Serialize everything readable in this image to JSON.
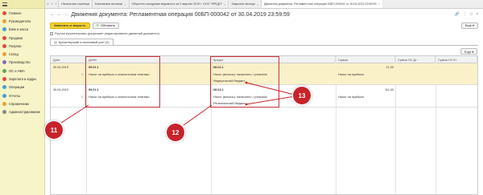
{
  "sidebar": {
    "items": [
      {
        "label": "Главное",
        "color": "#e24c3c"
      },
      {
        "label": "Руководителю",
        "color": "#e8a03b"
      },
      {
        "label": "Банк и касса",
        "color": "#4b9bd6"
      },
      {
        "label": "Продажи",
        "color": "#e24c3c"
      },
      {
        "label": "Покупки",
        "color": "#e24c3c"
      },
      {
        "label": "Склад",
        "color": "#e8a03b"
      },
      {
        "label": "Производство",
        "color": "#8a6bbe"
      },
      {
        "label": "ОС и НМА",
        "color": "#6aa84f"
      },
      {
        "label": "Зарплата и кадры",
        "color": "#e24c3c"
      },
      {
        "label": "Операции",
        "color": "#4b9bd6"
      },
      {
        "label": "Отчеты",
        "color": "#4b9bd6"
      },
      {
        "label": "Справочники",
        "color": "#e8a03b"
      },
      {
        "label": "Администрирование",
        "color": "#888888"
      }
    ]
  },
  "tabs": [
    {
      "label": "Начальная страница"
    },
    {
      "label": "Банковские выписки"
    },
    {
      "label": "Оборотно-сальдовая ведомость за 2 квартал 2019 г. ООО \"КРЕДО\""
    },
    {
      "label": "Закрытие месяца"
    },
    {
      "label": "Движения документа: Регламентная операция 00БП-000042 от 30.04.2019 23:59:59",
      "active": true
    }
  ],
  "title": "Движения документа: Регламентная операция 00БП-000042 от 30.04.2019 23:59:59",
  "toolbar": {
    "save_close": "Записать и закрыть",
    "refresh": "Обновить",
    "more": "Еще"
  },
  "manual_edit_label": "Ручная корректировка (разрешает редактирование движений документа)",
  "subtab_label": "Бухгалтерский и налоговый учет (2)",
  "grid_more": "Еще",
  "columns": {
    "date": "Дата",
    "debit": "Дебет",
    "credit": "Кредит",
    "amount": "Сумма",
    "nu_dt": "Сумма НУ Дт",
    "nu_kt": "Сумма НУ Кт"
  },
  "rows": [
    {
      "date": "30.04.2019",
      "num": "1",
      "debit_account": "99.01.1",
      "debit_sub": "Налог на прибыль и аналогичные платежи",
      "credit_account": "68.04.1",
      "credit_sub1": "Налог (взносы): начислено / уплачено",
      "credit_sub2": "Федеральный бюджет",
      "amount": "21,00",
      "content": "Налог на прибыль"
    },
    {
      "date": "30.04.2019",
      "num": "2",
      "debit_account": "99.01.1",
      "debit_sub": "Налог на прибыль и аналогичные платежи",
      "credit_account": "68.04.1",
      "credit_sub1": "Налог (взносы): начислено / уплачено",
      "credit_sub2": "Региональный бюджет",
      "amount": "111,00",
      "content": "Налог на прибыль"
    }
  ],
  "callouts": {
    "debit": "11",
    "credit": "12",
    "budget": "13"
  },
  "colors": {
    "accent": "#f5d131",
    "callout": "#c8232b",
    "sidebar_bg": "#f7f5c8",
    "selected_row": "#fbf1c8"
  }
}
